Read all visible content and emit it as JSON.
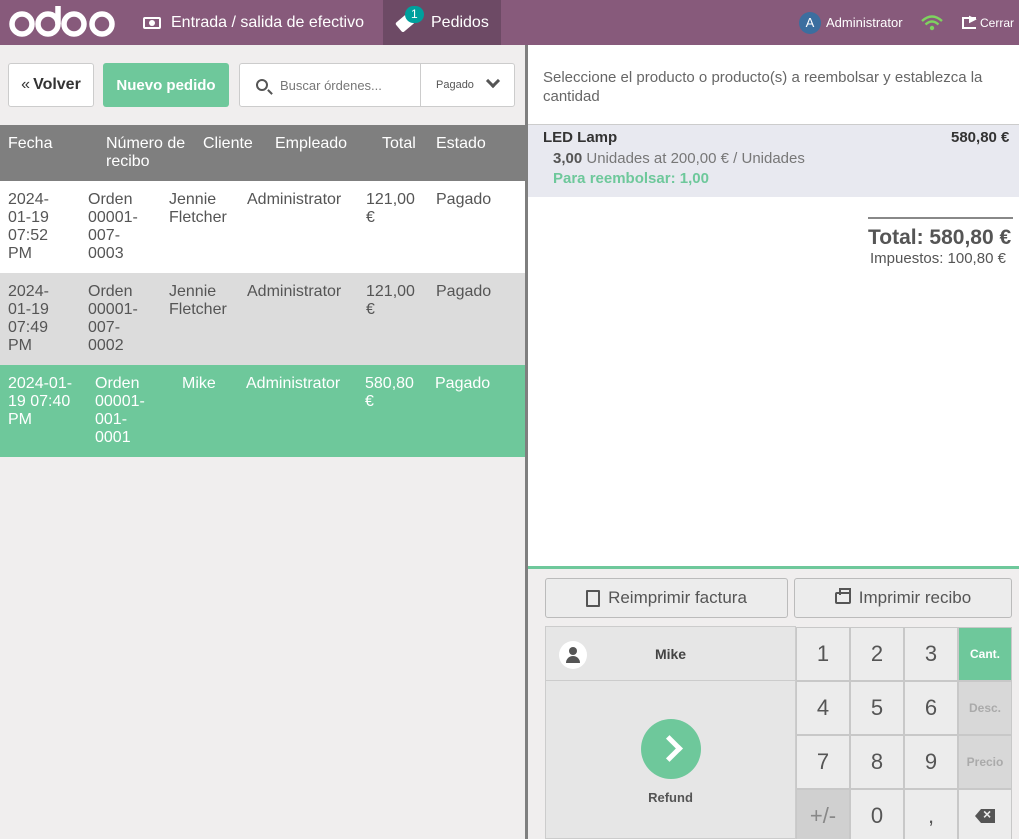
{
  "header": {
    "brand": "odoo",
    "cash_label": "Entrada / salida de efectivo",
    "orders_label": "Pedidos",
    "orders_badge": "1",
    "user_initial": "A",
    "user_name": "Administrator",
    "close_label": "Cerrar",
    "bar_color": "#875a7b"
  },
  "toolbar": {
    "back_label": "Volver",
    "new_order_label": "Nuevo pedido",
    "search_placeholder": "Buscar órdenes...",
    "filter_value": "Pagado"
  },
  "table": {
    "headers": [
      "Fecha",
      "Número de recibo",
      "Cliente",
      "Empleado",
      "Total",
      "Estado"
    ],
    "rows": [
      {
        "date": "2024-01-19 07:52 PM",
        "receipt": "Orden 00001-007-0003",
        "customer": "Jennie Fletcher",
        "employee": "Administrator",
        "total": "121,00 €",
        "state": "Pagado"
      },
      {
        "date": "2024-01-19 07:49 PM",
        "receipt": "Orden 00001-007-0002",
        "customer": "Jennie Fletcher",
        "employee": "Administrator",
        "total": "121,00 €",
        "state": "Pagado"
      },
      {
        "date": "2024-01-19 07:40 PM",
        "receipt": "Orden 00001-001-0001",
        "customer": "Mike",
        "employee": "Administrator",
        "total": "580,80 €",
        "state": "Pagado"
      }
    ]
  },
  "detail": {
    "instructions": "Seleccione el producto o producto(s) a reembolsar y establezca la cantidad",
    "line": {
      "product": "LED Lamp",
      "price": "580,80 €",
      "qty": "3,00",
      "qty_rest": " Unidades at 200,00 € / Unidades",
      "refund": "Para reembolsar: 1,00"
    },
    "total": "Total: 580,80 €",
    "taxes": "Impuestos: 100,80 €"
  },
  "actions": {
    "reprint_label": "Reimprimir factura",
    "print_label": "Imprimir recibo"
  },
  "numpad": {
    "customer_name": "Mike",
    "pay_label": "Refund",
    "keys": [
      "1",
      "2",
      "3",
      "4",
      "5",
      "6",
      "7",
      "8",
      "9",
      "+/-",
      "0",
      ","
    ],
    "modes": [
      "Cant.",
      "Desc.",
      "Precio"
    ],
    "accent_color": "#6ec89b"
  }
}
